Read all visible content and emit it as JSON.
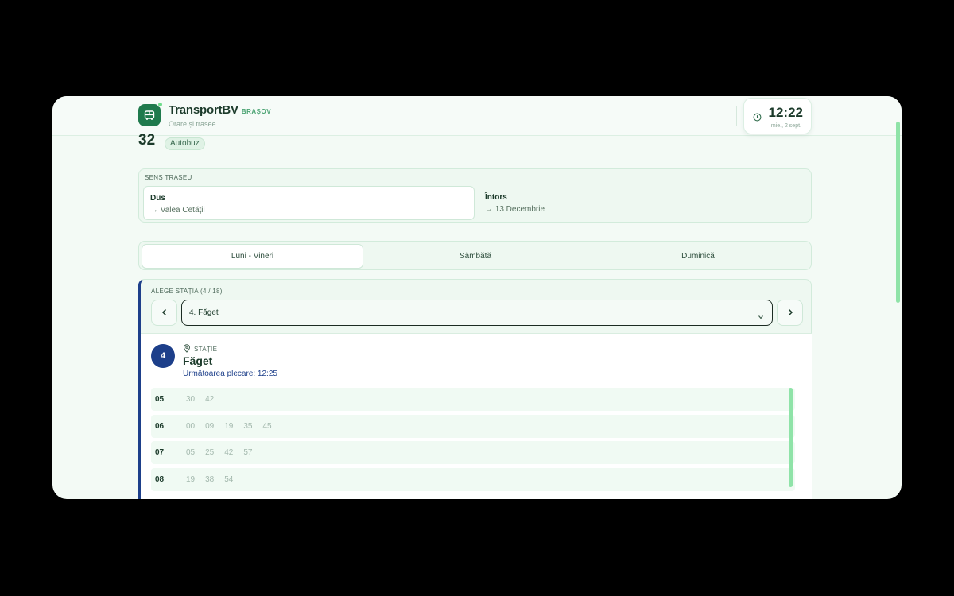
{
  "header": {
    "brand_name": "TransportBV",
    "brand_city": "BRAȘOV",
    "brand_subtitle": "Orare și trasee",
    "clock_time": "12:22",
    "clock_date": "mie., 2 sept."
  },
  "route": {
    "line_number": "32",
    "vehicle_type": "Autobuz"
  },
  "direction": {
    "label": "SENS TRASEU",
    "options": [
      {
        "title": "Dus",
        "destination": "→ Valea Cetății",
        "selected": true
      },
      {
        "title": "Întors",
        "destination": "→ 13 Decembrie",
        "selected": false
      }
    ]
  },
  "day_tabs": [
    {
      "label": "Luni - Vineri",
      "selected": true
    },
    {
      "label": "Sâmbătă",
      "selected": false
    },
    {
      "label": "Duminică",
      "selected": false
    }
  ],
  "station_picker": {
    "label": "ALEGE STAȚIA (4 / 18)",
    "selected_value": "4. Făget"
  },
  "station": {
    "number": "4",
    "kind_label": "STAȚIE",
    "name": "Făget",
    "next_departure": "Următoarea plecare: 12:25"
  },
  "schedule": [
    {
      "hour": "05",
      "minutes": [
        "30",
        "42"
      ]
    },
    {
      "hour": "06",
      "minutes": [
        "00",
        "09",
        "19",
        "35",
        "45"
      ]
    },
    {
      "hour": "07",
      "minutes": [
        "05",
        "25",
        "42",
        "57"
      ]
    },
    {
      "hour": "08",
      "minutes": [
        "19",
        "38",
        "54"
      ]
    }
  ],
  "colors": {
    "brand_green": "#1f7a4d",
    "accent_blue": "#1d3f8a",
    "scroll_green": "#8fe3a8"
  },
  "icons": {
    "logo": "bus-icon",
    "clock": "clock-icon",
    "station_kind": "map-pin-icon",
    "prev": "chevron-left-icon",
    "next": "chevron-right-icon",
    "select": "chevron-down-icon"
  }
}
